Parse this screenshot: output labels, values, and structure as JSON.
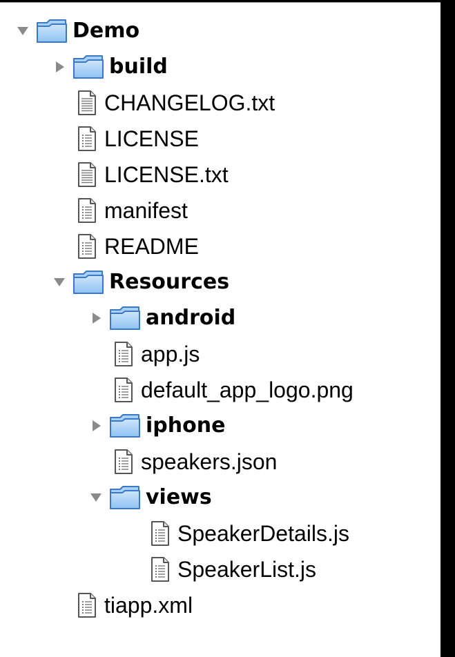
{
  "tree": [
    {
      "label": "Demo",
      "kind": "folder",
      "depth": 0,
      "expanded": true
    },
    {
      "label": "build",
      "kind": "folder",
      "depth": 1,
      "expanded": false
    },
    {
      "label": "CHANGELOG.txt",
      "kind": "text",
      "depth": 1
    },
    {
      "label": "LICENSE",
      "kind": "file",
      "depth": 1
    },
    {
      "label": "LICENSE.txt",
      "kind": "text",
      "depth": 1
    },
    {
      "label": "manifest",
      "kind": "file",
      "depth": 1
    },
    {
      "label": "README",
      "kind": "file",
      "depth": 1
    },
    {
      "label": "Resources",
      "kind": "folder",
      "depth": 1,
      "expanded": true
    },
    {
      "label": "android",
      "kind": "folder",
      "depth": 2,
      "expanded": false
    },
    {
      "label": "app.js",
      "kind": "file",
      "depth": 2
    },
    {
      "label": "default_app_logo.png",
      "kind": "file",
      "depth": 2
    },
    {
      "label": "iphone",
      "kind": "folder",
      "depth": 2,
      "expanded": false
    },
    {
      "label": "speakers.json",
      "kind": "file",
      "depth": 2
    },
    {
      "label": "views",
      "kind": "folder",
      "depth": 2,
      "expanded": true
    },
    {
      "label": "SpeakerDetails.js",
      "kind": "file",
      "depth": 3
    },
    {
      "label": "SpeakerList.js",
      "kind": "file",
      "depth": 3
    },
    {
      "label": "tiapp.xml",
      "kind": "file",
      "depth": 1
    }
  ],
  "colors": {
    "folder_body": "#8fc2f2",
    "folder_edge": "#3a78c4",
    "disclosure": "#8a8a8a",
    "doc_edge": "#555555"
  },
  "icons": {
    "folder": "folder-icon",
    "text": "text-document-icon",
    "file": "document-icon",
    "expanded": "disclosure-triangle-expanded-icon",
    "collapsed": "disclosure-triangle-collapsed-icon"
  }
}
